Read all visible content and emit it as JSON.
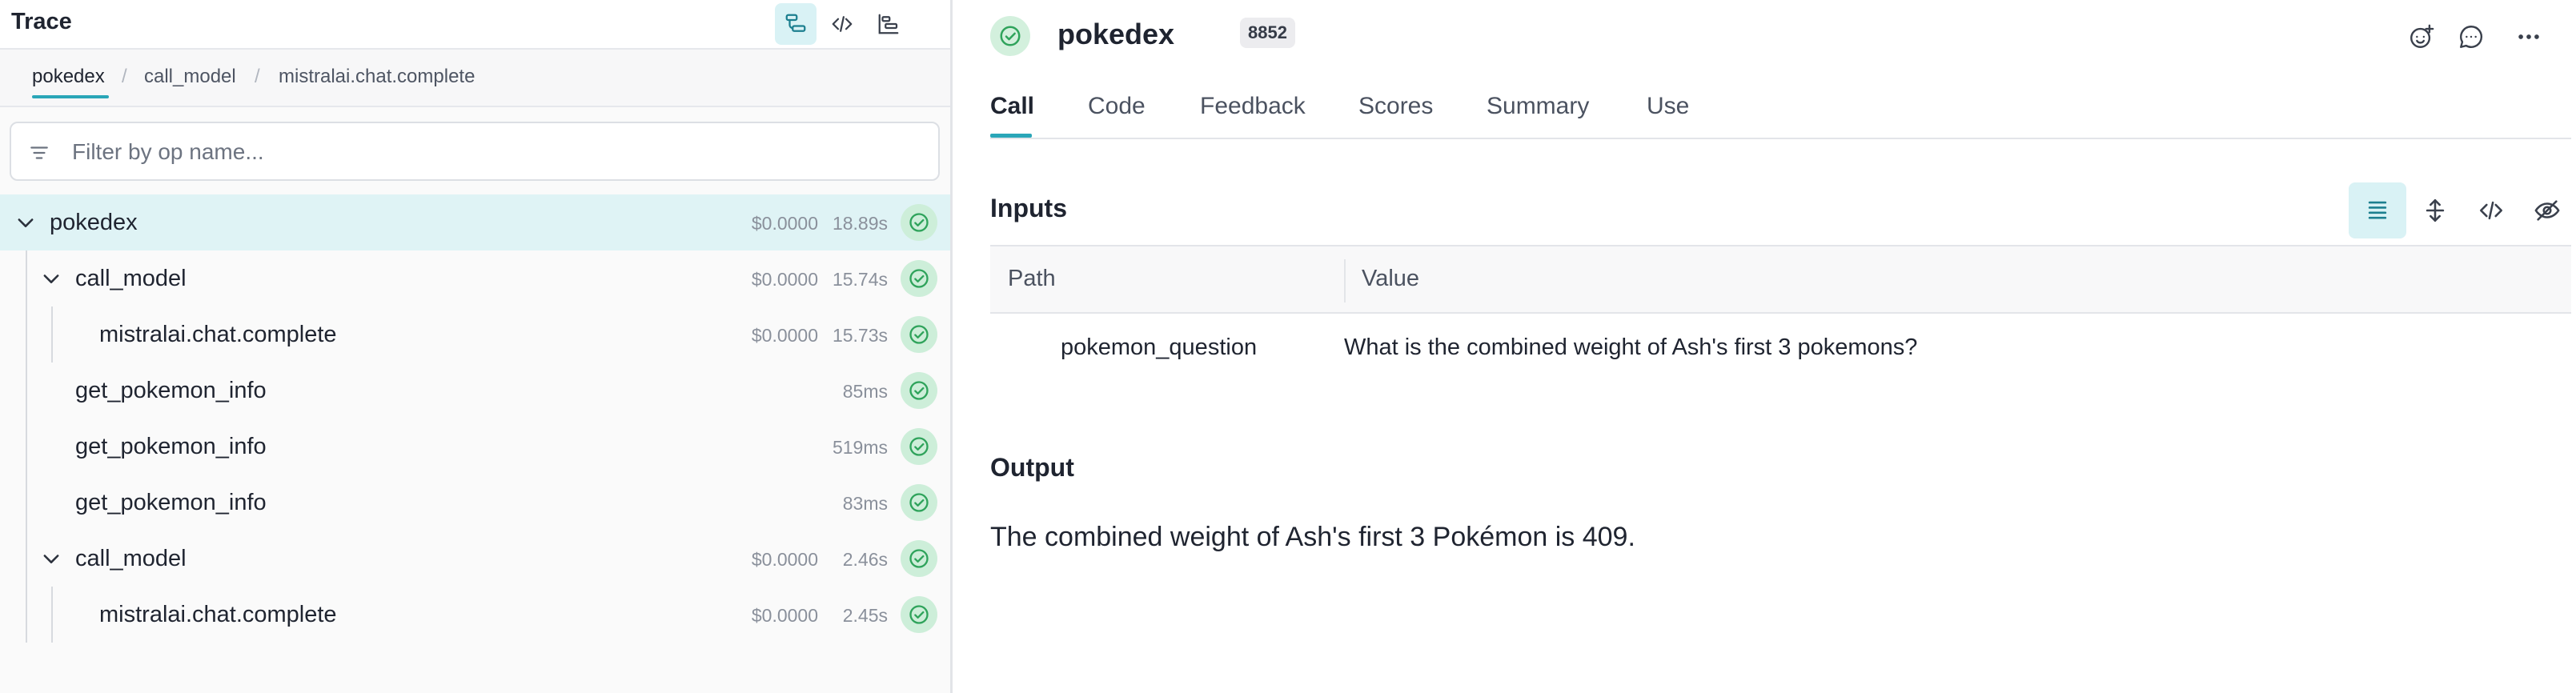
{
  "trace": {
    "title": "Trace",
    "breadcrumb": [
      "pokedex",
      "call_model",
      "mistralai.chat.complete"
    ],
    "filter_placeholder": "Filter by op name...",
    "rows": [
      {
        "name": "pokedex",
        "cost": "$0.0000",
        "duration": "18.89s"
      },
      {
        "name": "call_model",
        "cost": "$0.0000",
        "duration": "15.74s"
      },
      {
        "name": "mistralai.chat.complete",
        "cost": "$0.0000",
        "duration": "15.73s"
      },
      {
        "name": "get_pokemon_info",
        "cost": "",
        "duration": "85ms"
      },
      {
        "name": "get_pokemon_info",
        "cost": "",
        "duration": "519ms"
      },
      {
        "name": "get_pokemon_info",
        "cost": "",
        "duration": "83ms"
      },
      {
        "name": "call_model",
        "cost": "$0.0000",
        "duration": "2.46s"
      },
      {
        "name": "mistralai.chat.complete",
        "cost": "$0.0000",
        "duration": "2.45s"
      }
    ]
  },
  "call": {
    "title": "pokedex",
    "id_badge": "8852",
    "tabs": [
      "Call",
      "Code",
      "Feedback",
      "Scores",
      "Summary",
      "Use"
    ],
    "inputs": {
      "title": "Inputs",
      "columns": [
        "Path",
        "Value"
      ],
      "rows": [
        {
          "path": "pokemon_question",
          "value": "What is the combined weight of Ash's first 3 pokemons?"
        }
      ]
    },
    "output": {
      "title": "Output",
      "text": "The combined weight of Ash's first 3 Pokémon is 409."
    }
  },
  "colors": {
    "accent": "#2aa6b8",
    "selected_row": "#dff3f5",
    "status_success": "#2fa35b",
    "status_bg": "#cdeed9"
  },
  "icons": {
    "header": [
      "trace-tree-icon",
      "code-icon",
      "timeline-icon"
    ],
    "top_actions": [
      "add-reaction-icon",
      "comment-icon",
      "more-icon"
    ],
    "view_modes": [
      "list-view-icon",
      "expand-icon",
      "json-code-icon",
      "hide-icon"
    ]
  }
}
